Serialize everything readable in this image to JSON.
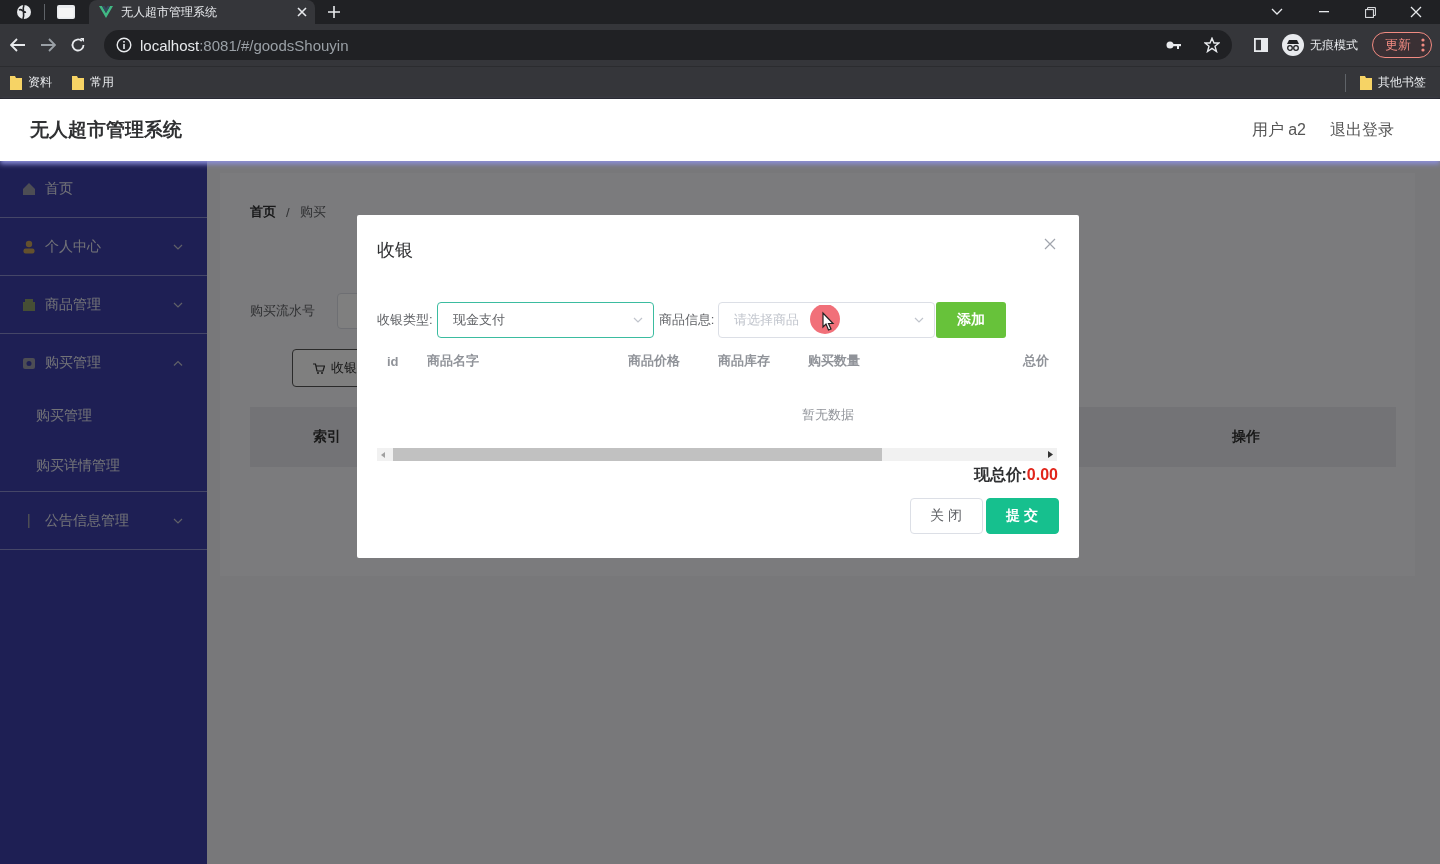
{
  "browser": {
    "tabs": [
      {
        "title": "无人超市管理系统",
        "selected": true
      }
    ],
    "address": {
      "host": "localhost",
      "path": ":8081/#/goodsShouyin"
    },
    "profile": "无痕模式",
    "update_button": "更新",
    "bookmarks": [
      {
        "label": "资料"
      },
      {
        "label": "常用"
      }
    ],
    "other_bookmarks": "其他书签"
  },
  "app": {
    "title": "无人超市管理系统",
    "user": "用户 a2",
    "logout": "退出登录",
    "sidebar": {
      "items": [
        {
          "label": "首页",
          "kind": "link"
        },
        {
          "label": "个人中心",
          "kind": "submenu",
          "expanded": false
        },
        {
          "label": "商品管理",
          "kind": "submenu",
          "expanded": false
        },
        {
          "label": "购买管理",
          "kind": "submenu",
          "expanded": true,
          "children": [
            {
              "label": "购买管理"
            },
            {
              "label": "购买详情管理"
            }
          ]
        },
        {
          "label": "公告信息管理",
          "kind": "submenu",
          "expanded": false
        }
      ]
    },
    "main": {
      "breadcrumb": [
        "首页",
        "购买"
      ],
      "breadcrumb_separator": "/",
      "search_label": "购买流水号",
      "cashier_button": "收银",
      "table": {
        "columns": [
          "索引",
          "操作"
        ]
      }
    }
  },
  "dialog": {
    "title": "收银",
    "payment_type": {
      "label": "收银类型:",
      "value": "现金支付",
      "focused": true
    },
    "goods": {
      "label": "商品信息:",
      "placeholder": "请选择商品",
      "focused": false
    },
    "add_button": "添加",
    "table": {
      "columns": [
        "id",
        "商品名字",
        "商品价格",
        "商品库存",
        "购买数量",
        "总价"
      ],
      "empty_text": "暂无数据"
    },
    "total": {
      "label": "现总价:",
      "value": "0.00"
    },
    "buttons": [
      {
        "label": "关闭",
        "kind": "secondary"
      },
      {
        "label": "提交",
        "kind": "primary"
      }
    ]
  }
}
